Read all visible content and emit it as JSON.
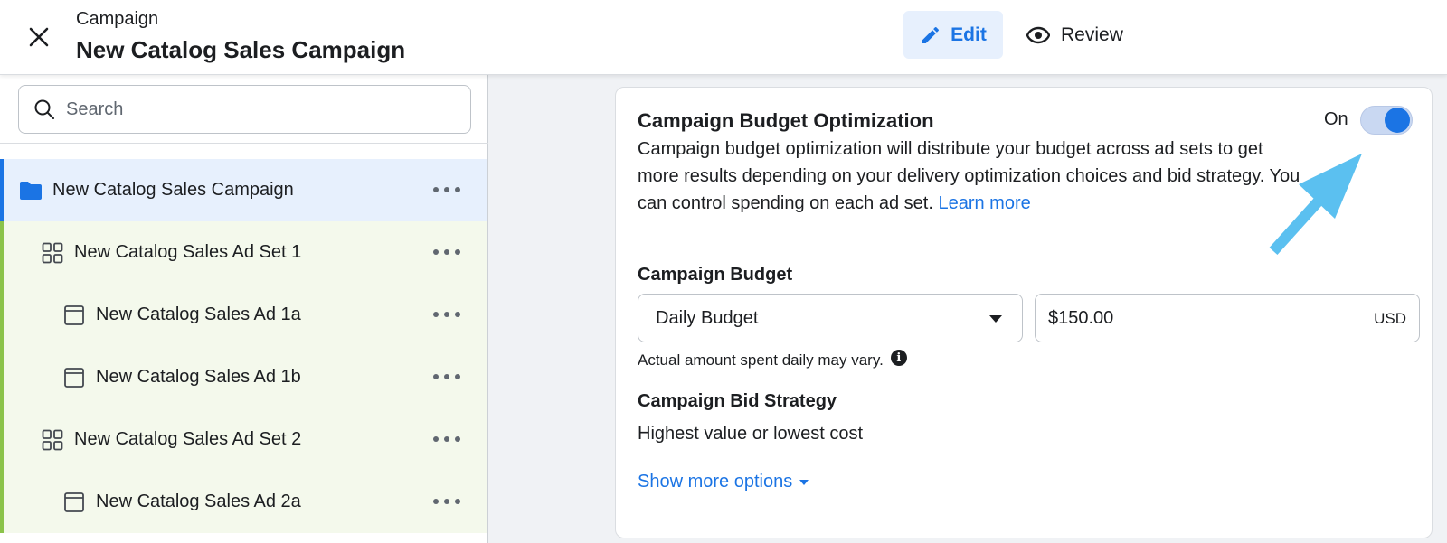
{
  "header": {
    "kicker": "Campaign",
    "title": "New Catalog Sales Campaign",
    "edit_label": "Edit",
    "review_label": "Review"
  },
  "sidebar": {
    "search_placeholder": "Search",
    "items": [
      {
        "label": "New Catalog Sales Campaign",
        "type": "campaign"
      },
      {
        "label": "New Catalog Sales Ad Set 1",
        "type": "adset"
      },
      {
        "label": "New Catalog Sales Ad 1a",
        "type": "ad"
      },
      {
        "label": "New Catalog Sales Ad 1b",
        "type": "ad"
      },
      {
        "label": "New Catalog Sales Ad Set 2",
        "type": "adset"
      },
      {
        "label": "New Catalog Sales Ad 2a",
        "type": "ad"
      }
    ]
  },
  "main": {
    "cbo_title": "Campaign Budget Optimization",
    "cbo_description": "Campaign budget optimization will distribute your budget across ad sets to get more results depending on your delivery optimization choices and bid strategy. You can control spending on each ad set.",
    "learn_more": "Learn more",
    "toggle_label": "On",
    "toggle_state": "on",
    "budget_label": "Campaign Budget",
    "budget_type": "Daily Budget",
    "budget_amount": "$150.00",
    "currency": "USD",
    "hint": "Actual amount spent daily may vary.",
    "bid_label": "Campaign Bid Strategy",
    "bid_value": "Highest value or lowest cost",
    "show_more": "Show more options"
  },
  "colors": {
    "accent": "#1b74e4",
    "campaign_row_bg": "#e7f0fd",
    "child_row_bg": "#f4f9ec",
    "child_row_border": "#8bc34a",
    "annotation_arrow": "#5bc0f0"
  }
}
